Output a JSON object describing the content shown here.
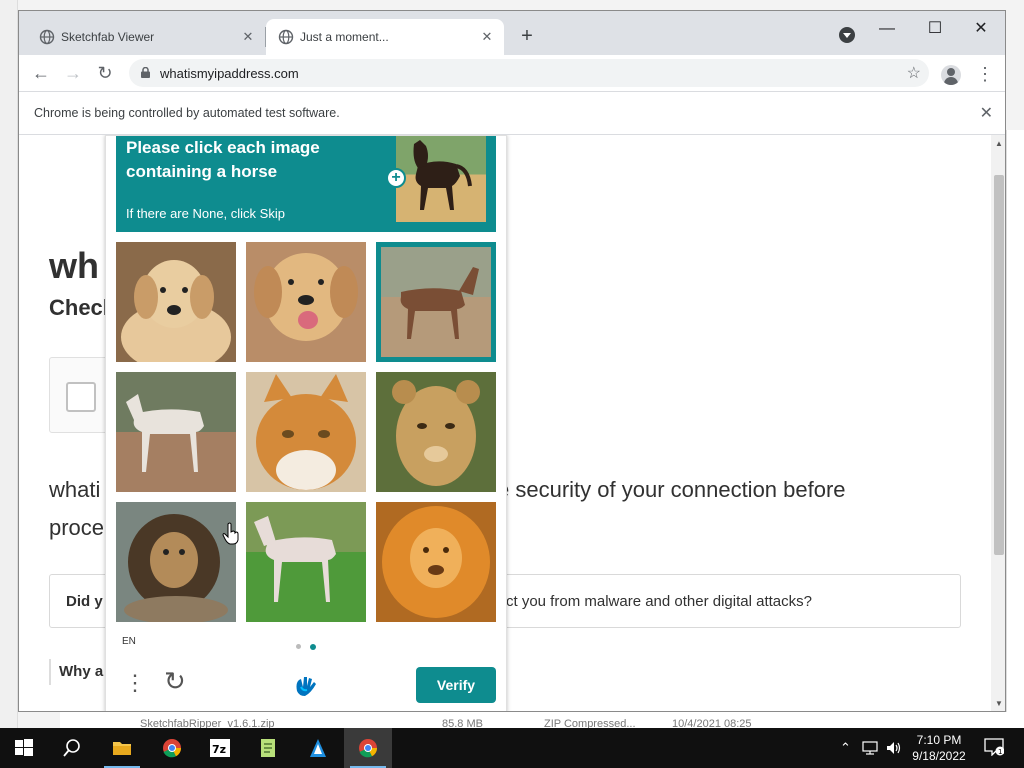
{
  "browser": {
    "tabs": [
      {
        "title": "Sketchfab Viewer",
        "close": "✕"
      },
      {
        "title": "Just a moment...",
        "close": "✕"
      }
    ],
    "new_tab": "+",
    "url": "whatismyipaddress.com",
    "infobar_text": "Chrome is being controlled by automated test software.",
    "infobar_close": "✕"
  },
  "page": {
    "heading": "wh",
    "subheading": "Check",
    "paragraph_start": "whati",
    "paragraph_end": "e security of your connection before",
    "paragraph_line2": "proce",
    "card_left": "Did y",
    "card_right": "ct you from malware and other digital attacks?",
    "why": "Why a"
  },
  "captcha": {
    "prompt": "Please click each image containing a horse",
    "hint": "If there are None, click Skip",
    "language": "EN",
    "verify_label": "Verify",
    "accent_color": "#0e8c8f",
    "tiles": [
      {
        "subject": "dog",
        "selected": false
      },
      {
        "subject": "dog",
        "selected": false
      },
      {
        "subject": "horse",
        "selected": true
      },
      {
        "subject": "horse",
        "selected": false
      },
      {
        "subject": "cat",
        "selected": false
      },
      {
        "subject": "lioness",
        "selected": false
      },
      {
        "subject": "lion",
        "selected": false
      },
      {
        "subject": "horse",
        "selected": false
      },
      {
        "subject": "lion",
        "selected": false
      }
    ],
    "page_dots": 2,
    "active_dot": 2
  },
  "background": {
    "file_name": "SketchfabRipper_v1.6.1.zip",
    "file_size": "85.8 MB",
    "file_type": "ZIP Compressed...",
    "file_date": "10/4/2021 08:25"
  },
  "taskbar": {
    "apps": [
      "start",
      "search",
      "file-explorer",
      "chrome",
      "7-zip",
      "notepad",
      "app",
      "chrome-active"
    ],
    "time": "7:10 PM",
    "date": "9/18/2022",
    "notifications": "1"
  }
}
